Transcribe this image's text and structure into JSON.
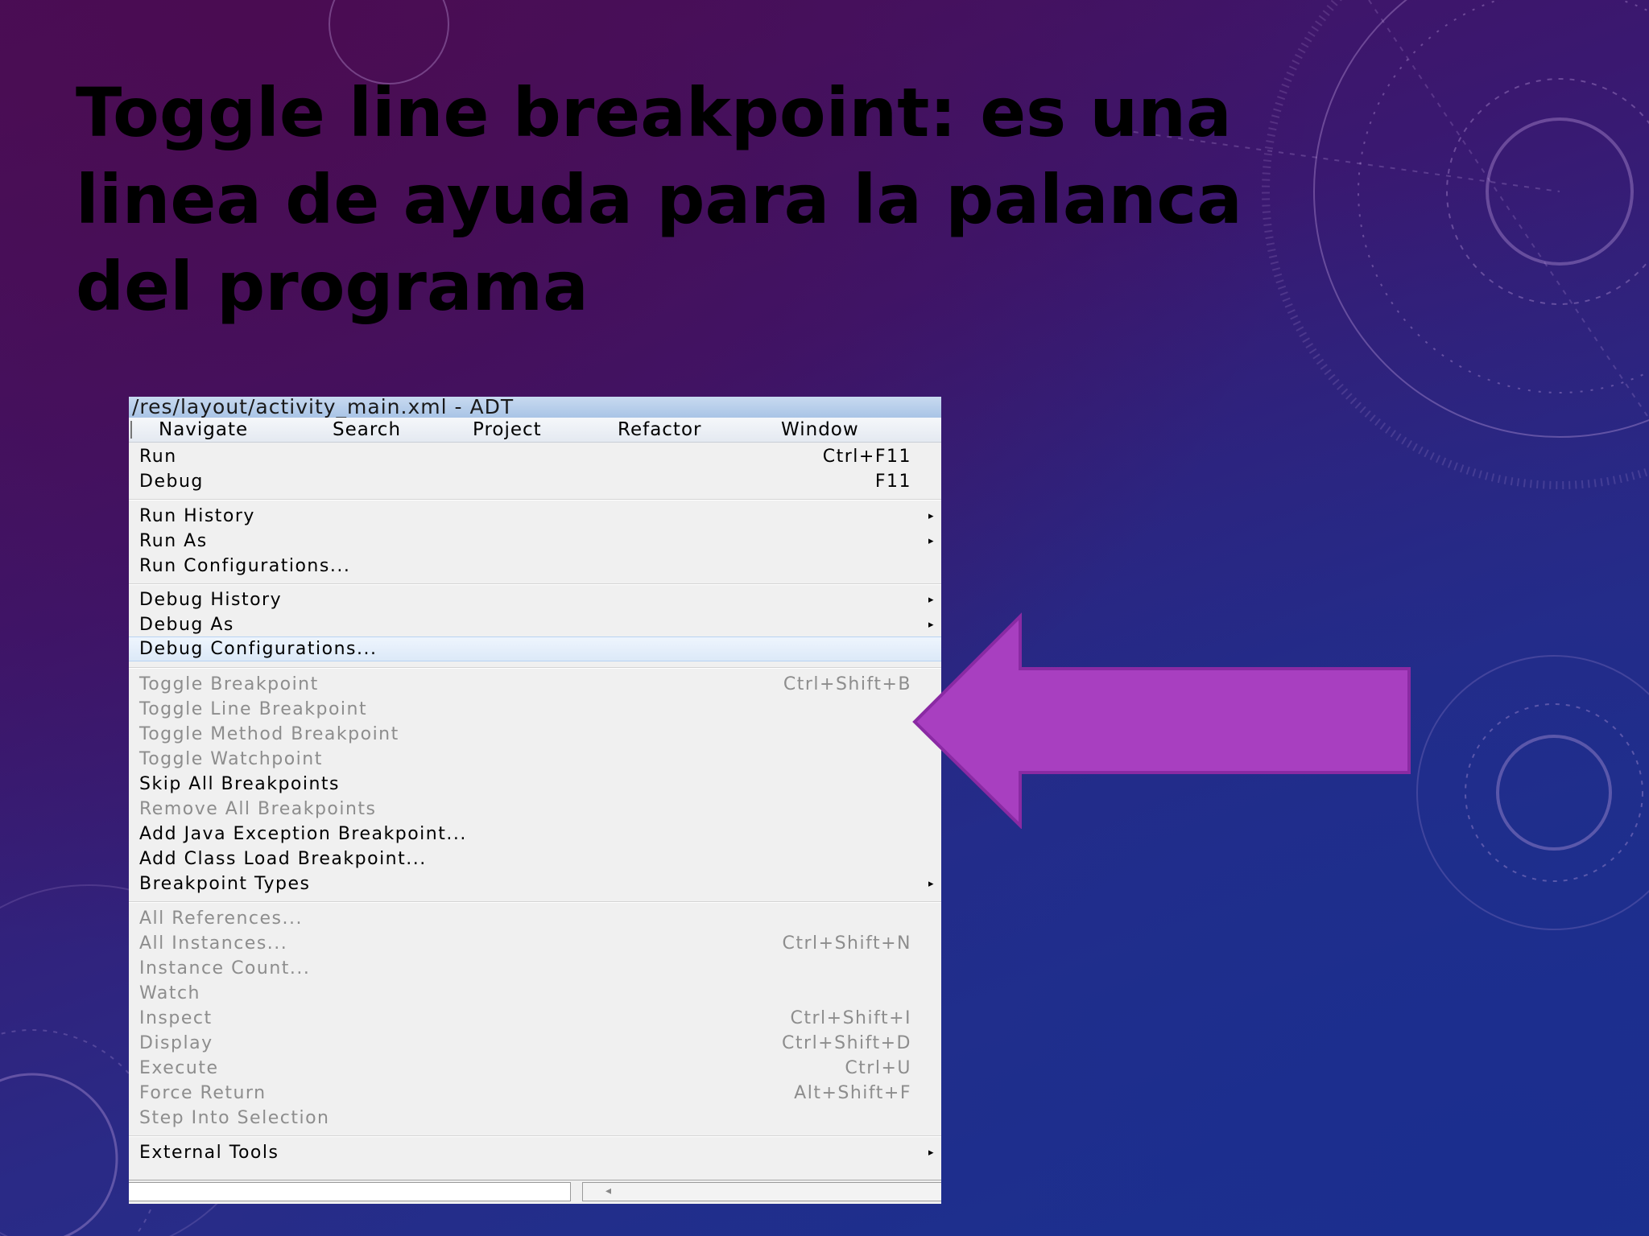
{
  "slide": {
    "title": "Toggle line breakpoint: es una linea de ayuda para la palanca del programa"
  },
  "window": {
    "title": "/res/layout/activity_main.xml - ADT"
  },
  "menubar": {
    "items": [
      "Navigate",
      "Search",
      "Project",
      "Refactor",
      "Window"
    ]
  },
  "menu": {
    "items": [
      {
        "label": "Run",
        "shortcut": "Ctrl+F11"
      },
      {
        "label": "Debug",
        "shortcut": "F11"
      },
      {
        "label": "Run History"
      },
      {
        "label": "Run As"
      },
      {
        "label": "Run Configurations..."
      },
      {
        "label": "Debug History"
      },
      {
        "label": "Debug As"
      },
      {
        "label": "Debug Configurations..."
      },
      {
        "label": "Toggle Breakpoint",
        "shortcut": "Ctrl+Shift+B"
      },
      {
        "label": "Toggle Line Breakpoint"
      },
      {
        "label": "Toggle Method Breakpoint"
      },
      {
        "label": "Toggle Watchpoint"
      },
      {
        "label": "Skip All Breakpoints"
      },
      {
        "label": "Remove All Breakpoints"
      },
      {
        "label": "Add Java Exception Breakpoint..."
      },
      {
        "label": "Add Class Load Breakpoint..."
      },
      {
        "label": "Breakpoint Types"
      },
      {
        "label": "All References..."
      },
      {
        "label": "All Instances...",
        "shortcut": "Ctrl+Shift+N"
      },
      {
        "label": "Instance Count..."
      },
      {
        "label": "Watch"
      },
      {
        "label": "Inspect",
        "shortcut": "Ctrl+Shift+I"
      },
      {
        "label": "Display",
        "shortcut": "Ctrl+Shift+D"
      },
      {
        "label": "Execute",
        "shortcut": "Ctrl+U"
      },
      {
        "label": "Force Return",
        "shortcut": "Alt+Shift+F"
      },
      {
        "label": "Step Into Selection"
      },
      {
        "label": "External Tools"
      }
    ],
    "submenu_arrow": "▸"
  },
  "colors": {
    "pointer_arrow": "#a83fc0",
    "menu_background": "#f0f0f0",
    "disabled_text": "#8d8d8d",
    "highlight": "#dce9f8"
  },
  "icons": {
    "pointer": "left-arrow-shape",
    "submenu": "submenu-arrow-icon"
  }
}
